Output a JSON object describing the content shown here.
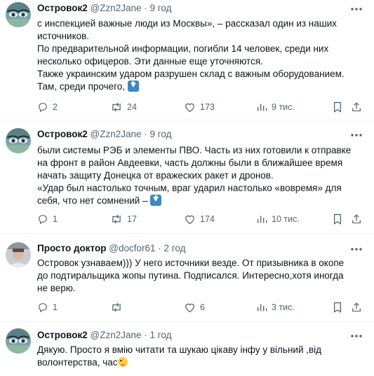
{
  "tweets": [
    {
      "name": "Островок2",
      "handle": "@Zzn2Jane",
      "sep": "·",
      "time": "9 год",
      "lines": [
        "с инспекцией важные люди из Москвы», – рассказал один из наших",
        "источников.",
        "По предварительной информации, погибли 14 человек, среди них",
        "несколько офицеров. Эти данные еще уточняются.",
        "Также украинским ударом разрушен склад с важным оборудованием.",
        "Там, среди прочего,"
      ],
      "replies": "2",
      "retweets": "24",
      "likes": "173",
      "views": "9 тис."
    },
    {
      "name": "Островок2",
      "handle": "@Zzn2Jane",
      "sep": "·",
      "time": "9 год",
      "lines": [
        "были системы РЭБ и элементы ПВО. Часть из них готовили к отправке",
        "на фронт в район Авдеевки, часть должны были в ближайшее время",
        "начать защиту Донецка от вражеских ракет и дронов.",
        "«Удар был настолько точным, враг ударил настолько «вовремя» для",
        "себя, что нет сомнений –"
      ],
      "replies": "1",
      "retweets": "17",
      "likes": "174",
      "views": "10 тис."
    },
    {
      "name": "Просто доктор",
      "handle": "@docfor61",
      "sep": "·",
      "time": "2 год",
      "lines": [
        "Островок узнаваем))) У него источники везде. От призывника в окопе",
        "до подтиральщика жопы путина. Подписался. Интересно,хотя иногда",
        "не верю."
      ],
      "replies": "1",
      "retweets": "",
      "likes": "6",
      "views": "3 тис."
    },
    {
      "name": "Островок2",
      "handle": "@Zzn2Jane",
      "sep": "·",
      "time": "1 год",
      "lines": [
        "Дякую. Просто я вмію читати та шукаю цікаву інфу у вільний ,від",
        "волонтерства, час"
      ]
    }
  ],
  "icons": {
    "more": "more-horizontal-icon",
    "reply": "reply-icon",
    "retweet": "retweet-icon",
    "like": "heart-icon",
    "views": "views-bar-chart-icon",
    "share": "share-icon",
    "emoji_down": "down-arrow-emoji-icon",
    "emoji_wink": "winking-face-emoji-icon"
  },
  "colors": {
    "text": "#0f1419",
    "muted": "#536471",
    "divider": "#eff3f4"
  }
}
